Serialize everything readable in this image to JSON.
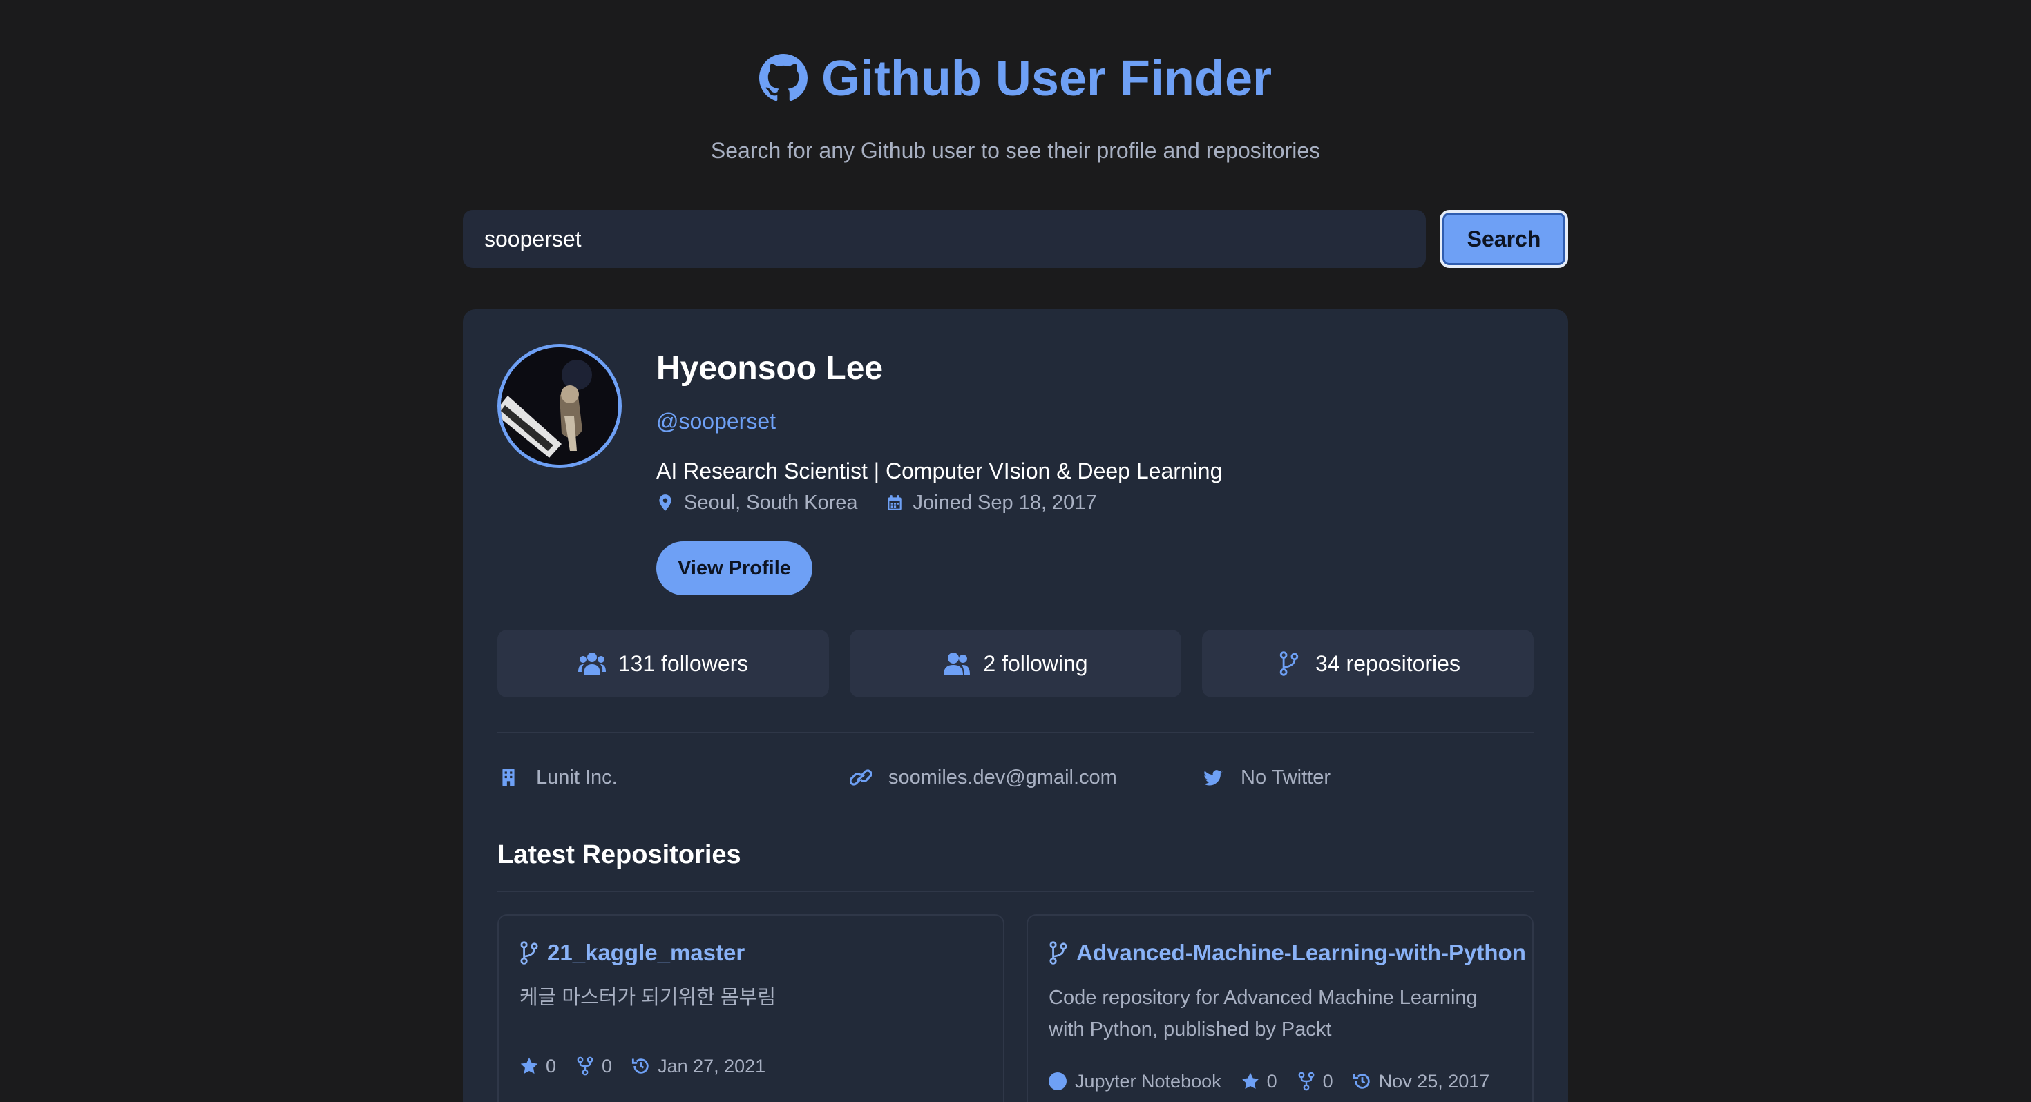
{
  "header": {
    "title": "Github User Finder",
    "subtitle": "Search for any Github user to see their profile and repositories"
  },
  "search": {
    "value": "sooperset",
    "button_label": "Search"
  },
  "profile": {
    "name": "Hyeonsoo Lee",
    "handle": "@sooperset",
    "bio": "AI Research Scientist | Computer VIsion & Deep Learning",
    "location": "Seoul, South Korea",
    "joined": "Joined Sep 18, 2017",
    "view_profile_label": "View Profile"
  },
  "stats": {
    "followers": "131 followers",
    "following": "2 following",
    "repositories": "34 repositories"
  },
  "info": {
    "company": "Lunit Inc.",
    "blog": "soomiles.dev@gmail.com",
    "twitter": "No Twitter"
  },
  "repos": {
    "section_title": "Latest Repositories",
    "items": [
      {
        "name": "21_kaggle_master",
        "description": "케글 마스터가 되기위한 몸부림",
        "language": "",
        "stars": "0",
        "forks": "0",
        "updated": "Jan 27, 2021"
      },
      {
        "name": "Advanced-Machine-Learning-with-Python",
        "description": "Code repository for Advanced Machine Learning with Python, published by Packt",
        "language": "Jupyter Notebook",
        "stars": "0",
        "forks": "0",
        "updated": "Nov 25, 2017"
      }
    ]
  },
  "colors": {
    "accent": "#6ea0f5",
    "background": "#1b1b1c",
    "card": "#222a39"
  }
}
